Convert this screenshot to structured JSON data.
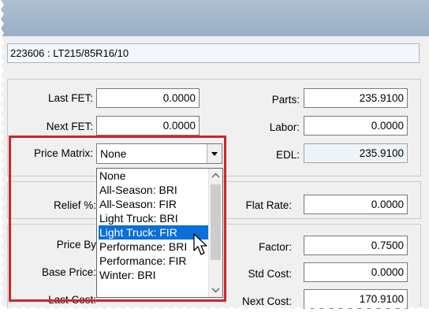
{
  "header": {
    "path_text": "223606 : LT215/85R16/10"
  },
  "fields": {
    "last_fet_label": "Last FET:",
    "last_fet_value": "0.0000",
    "next_fet_label": "Next FET:",
    "next_fet_value": "0.0000",
    "parts_label": "Parts:",
    "parts_value": "235.9100",
    "labor_label": "Labor:",
    "labor_value": "0.0000",
    "edl_label": "EDL:",
    "edl_value": "235.9100",
    "price_matrix_label": "Price Matrix:",
    "relief_label": "Relief %:",
    "flat_rate_label": "Flat Rate:",
    "flat_rate_value": "0.0000",
    "price_by_label": "Price By",
    "factor_label": "Factor:",
    "factor_value": "0.7500",
    "base_price_label": "Base Price:",
    "std_cost_label": "Std Cost:",
    "std_cost_value": "0.0000",
    "last_cost_label": "Last Cost:",
    "next_cost_label": "Next Cost:",
    "next_cost_value": "170.9100"
  },
  "price_matrix": {
    "selected_value": "None",
    "options": [
      "None",
      "All-Season: BRI",
      "All-Season: FIR",
      "Light Truck: BRI",
      "Light Truck: FIR",
      "Performance: BRI",
      "Performance: FIR",
      "Winter: BRI"
    ],
    "highlighted": "Light Truck: FIR"
  },
  "colors": {
    "highlight": "#0a6fd6",
    "callout": "#d2232a",
    "titlebar": "#a6b8cc"
  },
  "icons": {
    "combo_arrow": "chevron-down-icon",
    "scroll_up": "scroll-up-arrow-icon",
    "scroll_down": "scroll-down-arrow-icon",
    "pointer": "mouse-pointer-icon"
  }
}
